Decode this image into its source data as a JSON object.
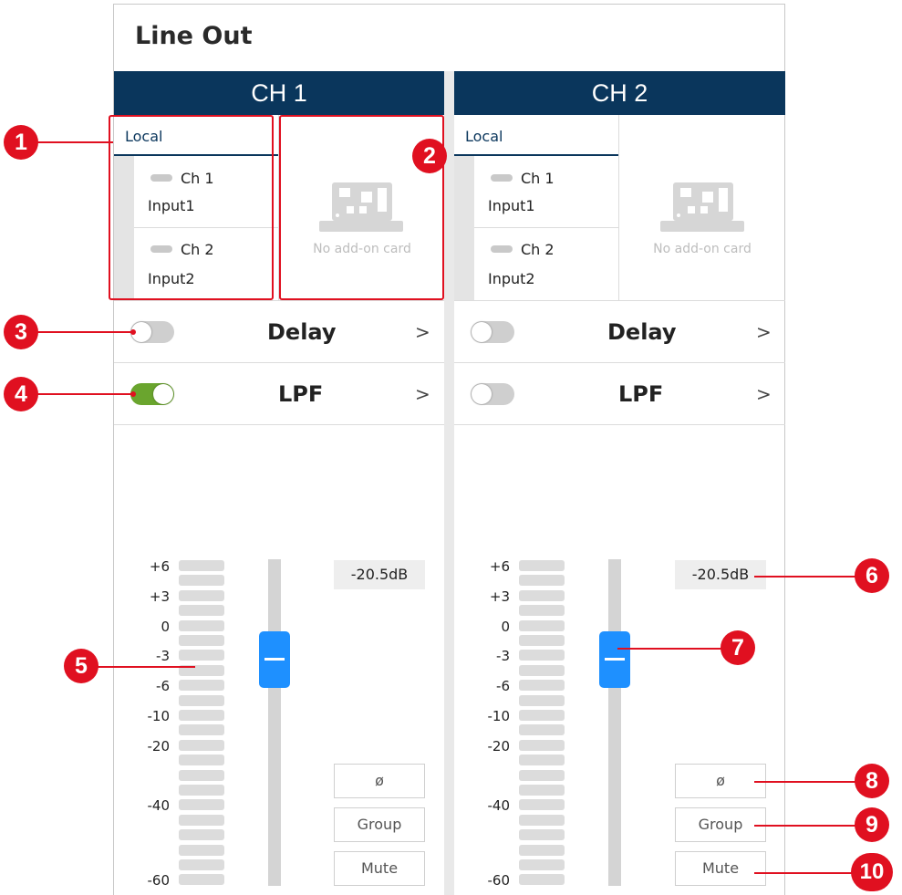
{
  "title": "Line Out",
  "channels": [
    {
      "header": "CH 1",
      "local_label": "Local",
      "inputs": [
        {
          "channel": "Ch 1",
          "name": "Input1"
        },
        {
          "channel": "Ch 2",
          "name": "Input2"
        }
      ],
      "addon_text": "No add-on card",
      "delay": {
        "label": "Delay",
        "enabled": false,
        "chevron": ">"
      },
      "lpf": {
        "label": "LPF",
        "enabled": true,
        "chevron": ">"
      },
      "db_readout": "-20.5dB",
      "buttons": {
        "phase": "ø",
        "group": "Group",
        "mute": "Mute"
      }
    },
    {
      "header": "CH 2",
      "local_label": "Local",
      "inputs": [
        {
          "channel": "Ch 1",
          "name": "Input1"
        },
        {
          "channel": "Ch 2",
          "name": "Input2"
        }
      ],
      "addon_text": "No add-on card",
      "delay": {
        "label": "Delay",
        "enabled": false,
        "chevron": ">"
      },
      "lpf": {
        "label": "LPF",
        "enabled": false,
        "chevron": ">"
      },
      "db_readout": "-20.5dB",
      "buttons": {
        "phase": "ø",
        "group": "Group",
        "mute": "Mute"
      }
    }
  ],
  "meter_scale": [
    "+6",
    "+3",
    "0",
    "-3",
    "-6",
    "-10",
    "-20",
    "-40",
    "-60"
  ],
  "fader_level_db": -20.5,
  "callouts": [
    "1",
    "2",
    "3",
    "4",
    "5",
    "6",
    "7",
    "8",
    "9",
    "10"
  ],
  "colors": {
    "header_bg": "#0a365c",
    "toggle_on": "#6aa52e",
    "fader_thumb": "#1e90ff",
    "annotation": "#e01020"
  }
}
